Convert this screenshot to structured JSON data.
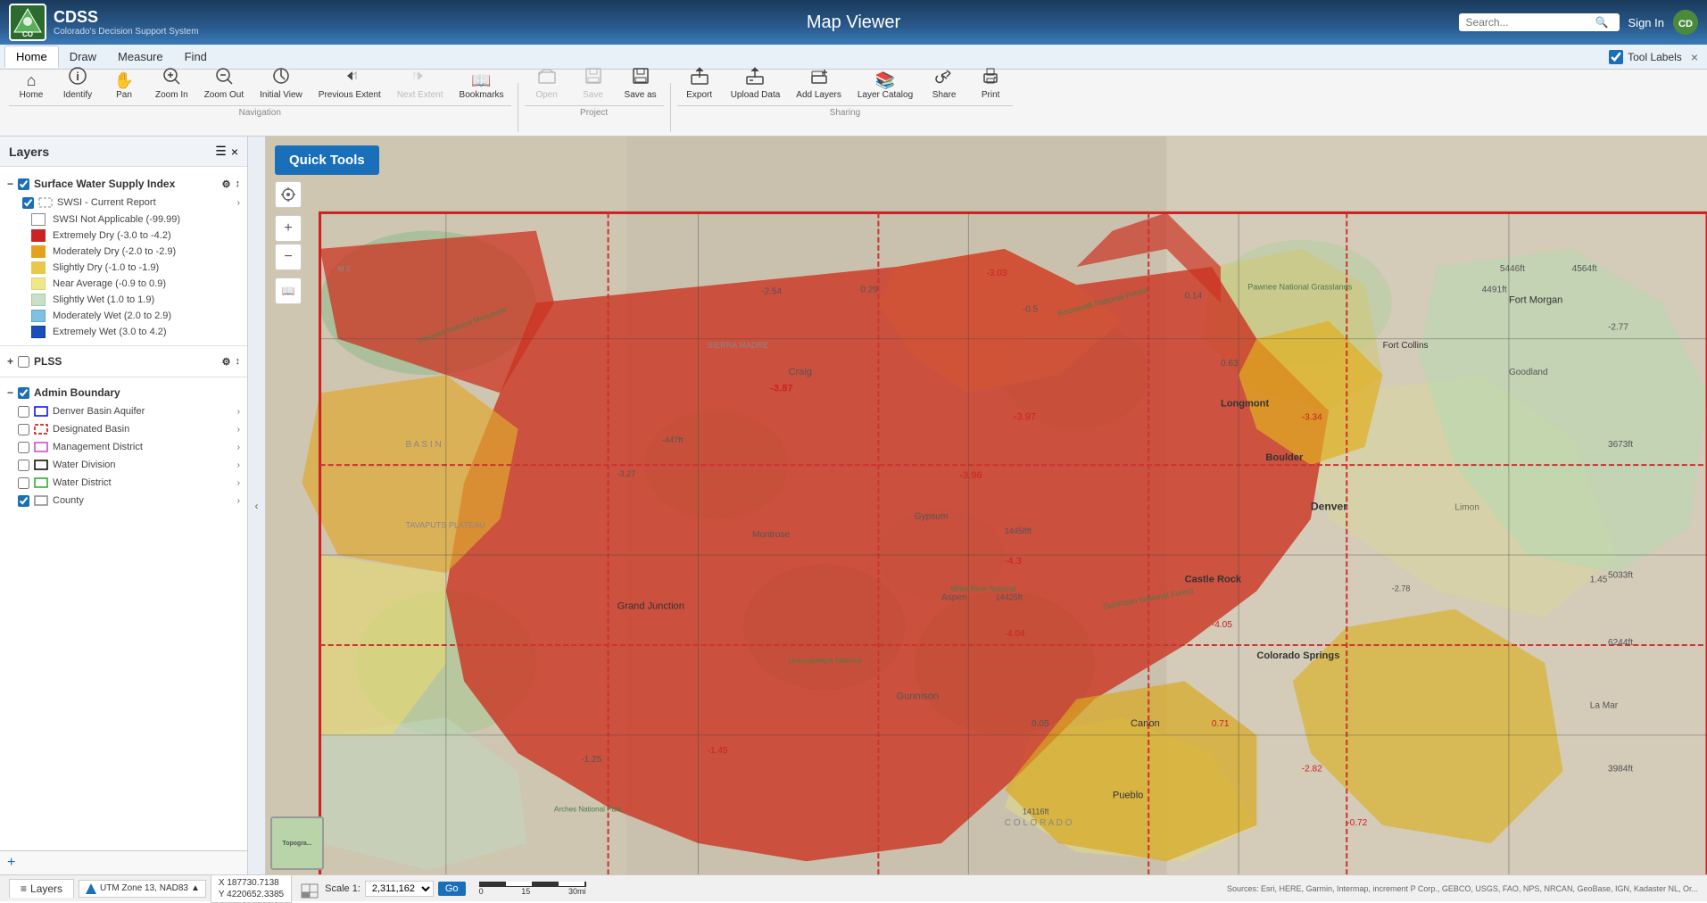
{
  "header": {
    "logo_text": "Co",
    "app_name": "CDSS",
    "app_subtitle": "Colorado's Decision Support System",
    "map_title": "Map Viewer",
    "search_placeholder": "Search...",
    "sign_in": "Sign In",
    "user_initials": "CD"
  },
  "nav_tabs": [
    {
      "id": "home",
      "label": "Home",
      "active": true
    },
    {
      "id": "draw",
      "label": "Draw",
      "active": false
    },
    {
      "id": "measure",
      "label": "Measure",
      "active": false
    },
    {
      "id": "find",
      "label": "Find",
      "active": false
    }
  ],
  "tool_labels": {
    "label": "Tool Labels",
    "checked": true,
    "close_icon": "×"
  },
  "toolbar": {
    "navigation": {
      "section_label": "Navigation",
      "buttons": [
        {
          "id": "home",
          "icon": "⌂",
          "label": "Home"
        },
        {
          "id": "identify",
          "icon": "ℹ",
          "label": "Identify"
        },
        {
          "id": "pan",
          "icon": "✋",
          "label": "Pan"
        },
        {
          "id": "zoom-in",
          "icon": "+",
          "label": "Zoom In"
        },
        {
          "id": "zoom-out",
          "icon": "−",
          "label": "Zoom Out"
        },
        {
          "id": "initial-view",
          "icon": "↺",
          "label": "Initial View"
        },
        {
          "id": "previous-extent",
          "icon": "←",
          "label": "Previous Extent"
        },
        {
          "id": "next-extent",
          "icon": "→",
          "label": "Next Extent"
        },
        {
          "id": "bookmarks",
          "icon": "📖",
          "label": "Bookmarks"
        }
      ]
    },
    "project": {
      "section_label": "Project",
      "buttons": [
        {
          "id": "open",
          "icon": "📂",
          "label": "Open",
          "disabled": true
        },
        {
          "id": "save",
          "icon": "💾",
          "label": "Save",
          "disabled": true
        },
        {
          "id": "save-as",
          "icon": "💾",
          "label": "Save as",
          "disabled": false
        }
      ]
    },
    "sharing": {
      "section_label": "Sharing",
      "buttons": [
        {
          "id": "export",
          "icon": "📤",
          "label": "Export"
        },
        {
          "id": "upload-data",
          "icon": "⬆",
          "label": "Upload Data"
        },
        {
          "id": "add-layers",
          "icon": "➕",
          "label": "Add Layers"
        },
        {
          "id": "layer-catalog",
          "icon": "📚",
          "label": "Layer Catalog"
        },
        {
          "id": "share",
          "icon": "📤",
          "label": "Share"
        },
        {
          "id": "print",
          "icon": "🖨",
          "label": "Print"
        }
      ]
    }
  },
  "sidebar": {
    "title": "Layers",
    "layer_groups": [
      {
        "id": "swsi",
        "name": "Surface Water Supply Index",
        "checked": true,
        "expanded": true,
        "children": [
          {
            "id": "swsi-current",
            "name": "SWSI - Current Report",
            "checked": true,
            "has_arrow": true,
            "children": [
              {
                "id": "swsi-na",
                "name": "SWSI Not Applicable (-99.99)",
                "color": "white",
                "border": "#888"
              },
              {
                "id": "ext-dry",
                "name": "Extremely Dry (-3.0 to -4.2)",
                "color": "#cc2222"
              },
              {
                "id": "mod-dry",
                "name": "Moderately Dry (-2.0 to -2.9)",
                "color": "#e6a020"
              },
              {
                "id": "sli-dry",
                "name": "Slightly Dry (-1.0 to -1.9)",
                "color": "#e8c84a"
              },
              {
                "id": "near-avg",
                "name": "Near Average (-0.9 to 0.9)",
                "color": "#f0e888"
              },
              {
                "id": "sli-wet",
                "name": "Slightly Wet (1.0 to 1.9)",
                "color": "#c8e0c8"
              },
              {
                "id": "mod-wet",
                "name": "Moderately Wet (2.0 to 2.9)",
                "color": "#80c0e0"
              },
              {
                "id": "ext-wet",
                "name": "Extremely Wet (3.0 to 4.2)",
                "color": "#1a4fba"
              }
            ]
          }
        ]
      },
      {
        "id": "plss",
        "name": "PLSS",
        "checked": false,
        "expanded": false
      },
      {
        "id": "admin-boundary",
        "name": "Admin Boundary",
        "checked": true,
        "expanded": true,
        "children": [
          {
            "id": "denver-basin",
            "name": "Denver Basin Aquifer",
            "checked": false,
            "color": null,
            "border": "#0000ff",
            "has_arrow": true
          },
          {
            "id": "designated-basin",
            "name": "Designated Basin",
            "checked": false,
            "color": null,
            "border": "#cc0000",
            "dashed": true,
            "has_arrow": true
          },
          {
            "id": "mgmt-district",
            "name": "Management District",
            "checked": false,
            "color": null,
            "border": "#cc44cc",
            "has_arrow": true
          },
          {
            "id": "water-division",
            "name": "Water Division",
            "checked": false,
            "color": null,
            "border": "#000000",
            "has_arrow": true
          },
          {
            "id": "water-district",
            "name": "Water District",
            "checked": false,
            "color": null,
            "border": "#22aa22",
            "has_arrow": true
          },
          {
            "id": "county",
            "name": "County",
            "checked": true,
            "color": null,
            "border": "#888888",
            "has_arrow": true
          }
        ]
      }
    ]
  },
  "quick_tools": {
    "label": "Quick Tools"
  },
  "map_nav": {
    "locate_icon": "⊕",
    "zoom_in_icon": "+",
    "zoom_out_icon": "−",
    "bookmark_icon": "📖"
  },
  "bottom_bar": {
    "layers_tab": "Layers",
    "utm_zone": "UTM Zone 13, NAD83",
    "coord_x": "X 187730.7138",
    "coord_y": "Y 4220652.3385",
    "scale_label": "Scale 1:",
    "scale_value": "2,311,162",
    "go_btn": "Go",
    "scale_bar_labels": [
      "0",
      "15",
      "30mi"
    ],
    "attribution": "Sources: Esri, HERE, Garmin, Intermap, increment P Corp., GEBCO, USGS, FAO, NPS, NRCAN, GeoBase, IGN, Kadaster NL, Or..."
  },
  "basemap": {
    "label": "Topogra..."
  }
}
